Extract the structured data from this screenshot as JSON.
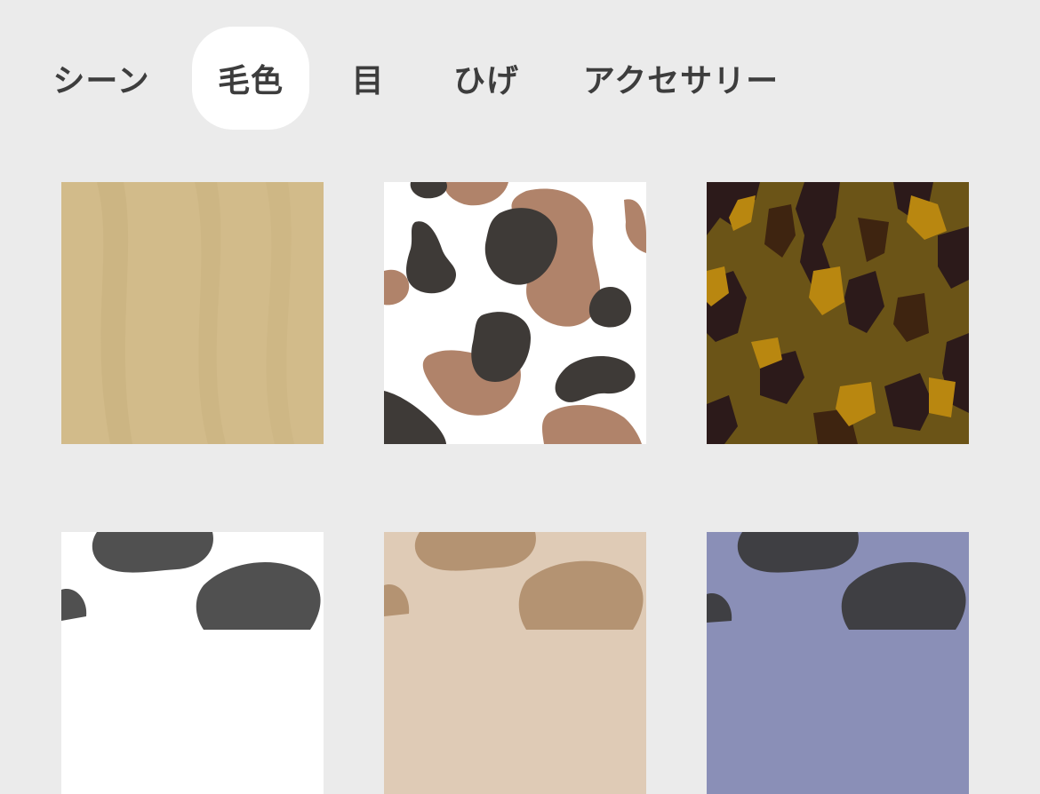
{
  "tabs": [
    {
      "label": "シーン",
      "active": false
    },
    {
      "label": "毛色",
      "active": true
    },
    {
      "label": "目",
      "active": false
    },
    {
      "label": "ひげ",
      "active": false
    },
    {
      "label": "アクセサリー",
      "active": false
    }
  ],
  "patterns": [
    {
      "name": "beige-plain",
      "colors": {
        "base": "#d2bb8a",
        "streak": "#c4ab76"
      }
    },
    {
      "name": "cow-white-brown-dark",
      "colors": {
        "base": "#ffffff",
        "a": "#b0836a",
        "b": "#3e3a37"
      }
    },
    {
      "name": "camo-brown-gold",
      "colors": {
        "base": "#6b5417",
        "a": "#2c1a1a",
        "b": "#b98710",
        "c": "#3e2410"
      }
    },
    {
      "name": "cow-white-gray",
      "colors": {
        "base": "#ffffff",
        "a": "#505050"
      }
    },
    {
      "name": "cow-beige-brown",
      "colors": {
        "base": "#dfcbb6",
        "a": "#b49372"
      }
    },
    {
      "name": "cow-lavender-dark",
      "colors": {
        "base": "#8a8fb7",
        "a": "#3f3f43"
      }
    }
  ]
}
